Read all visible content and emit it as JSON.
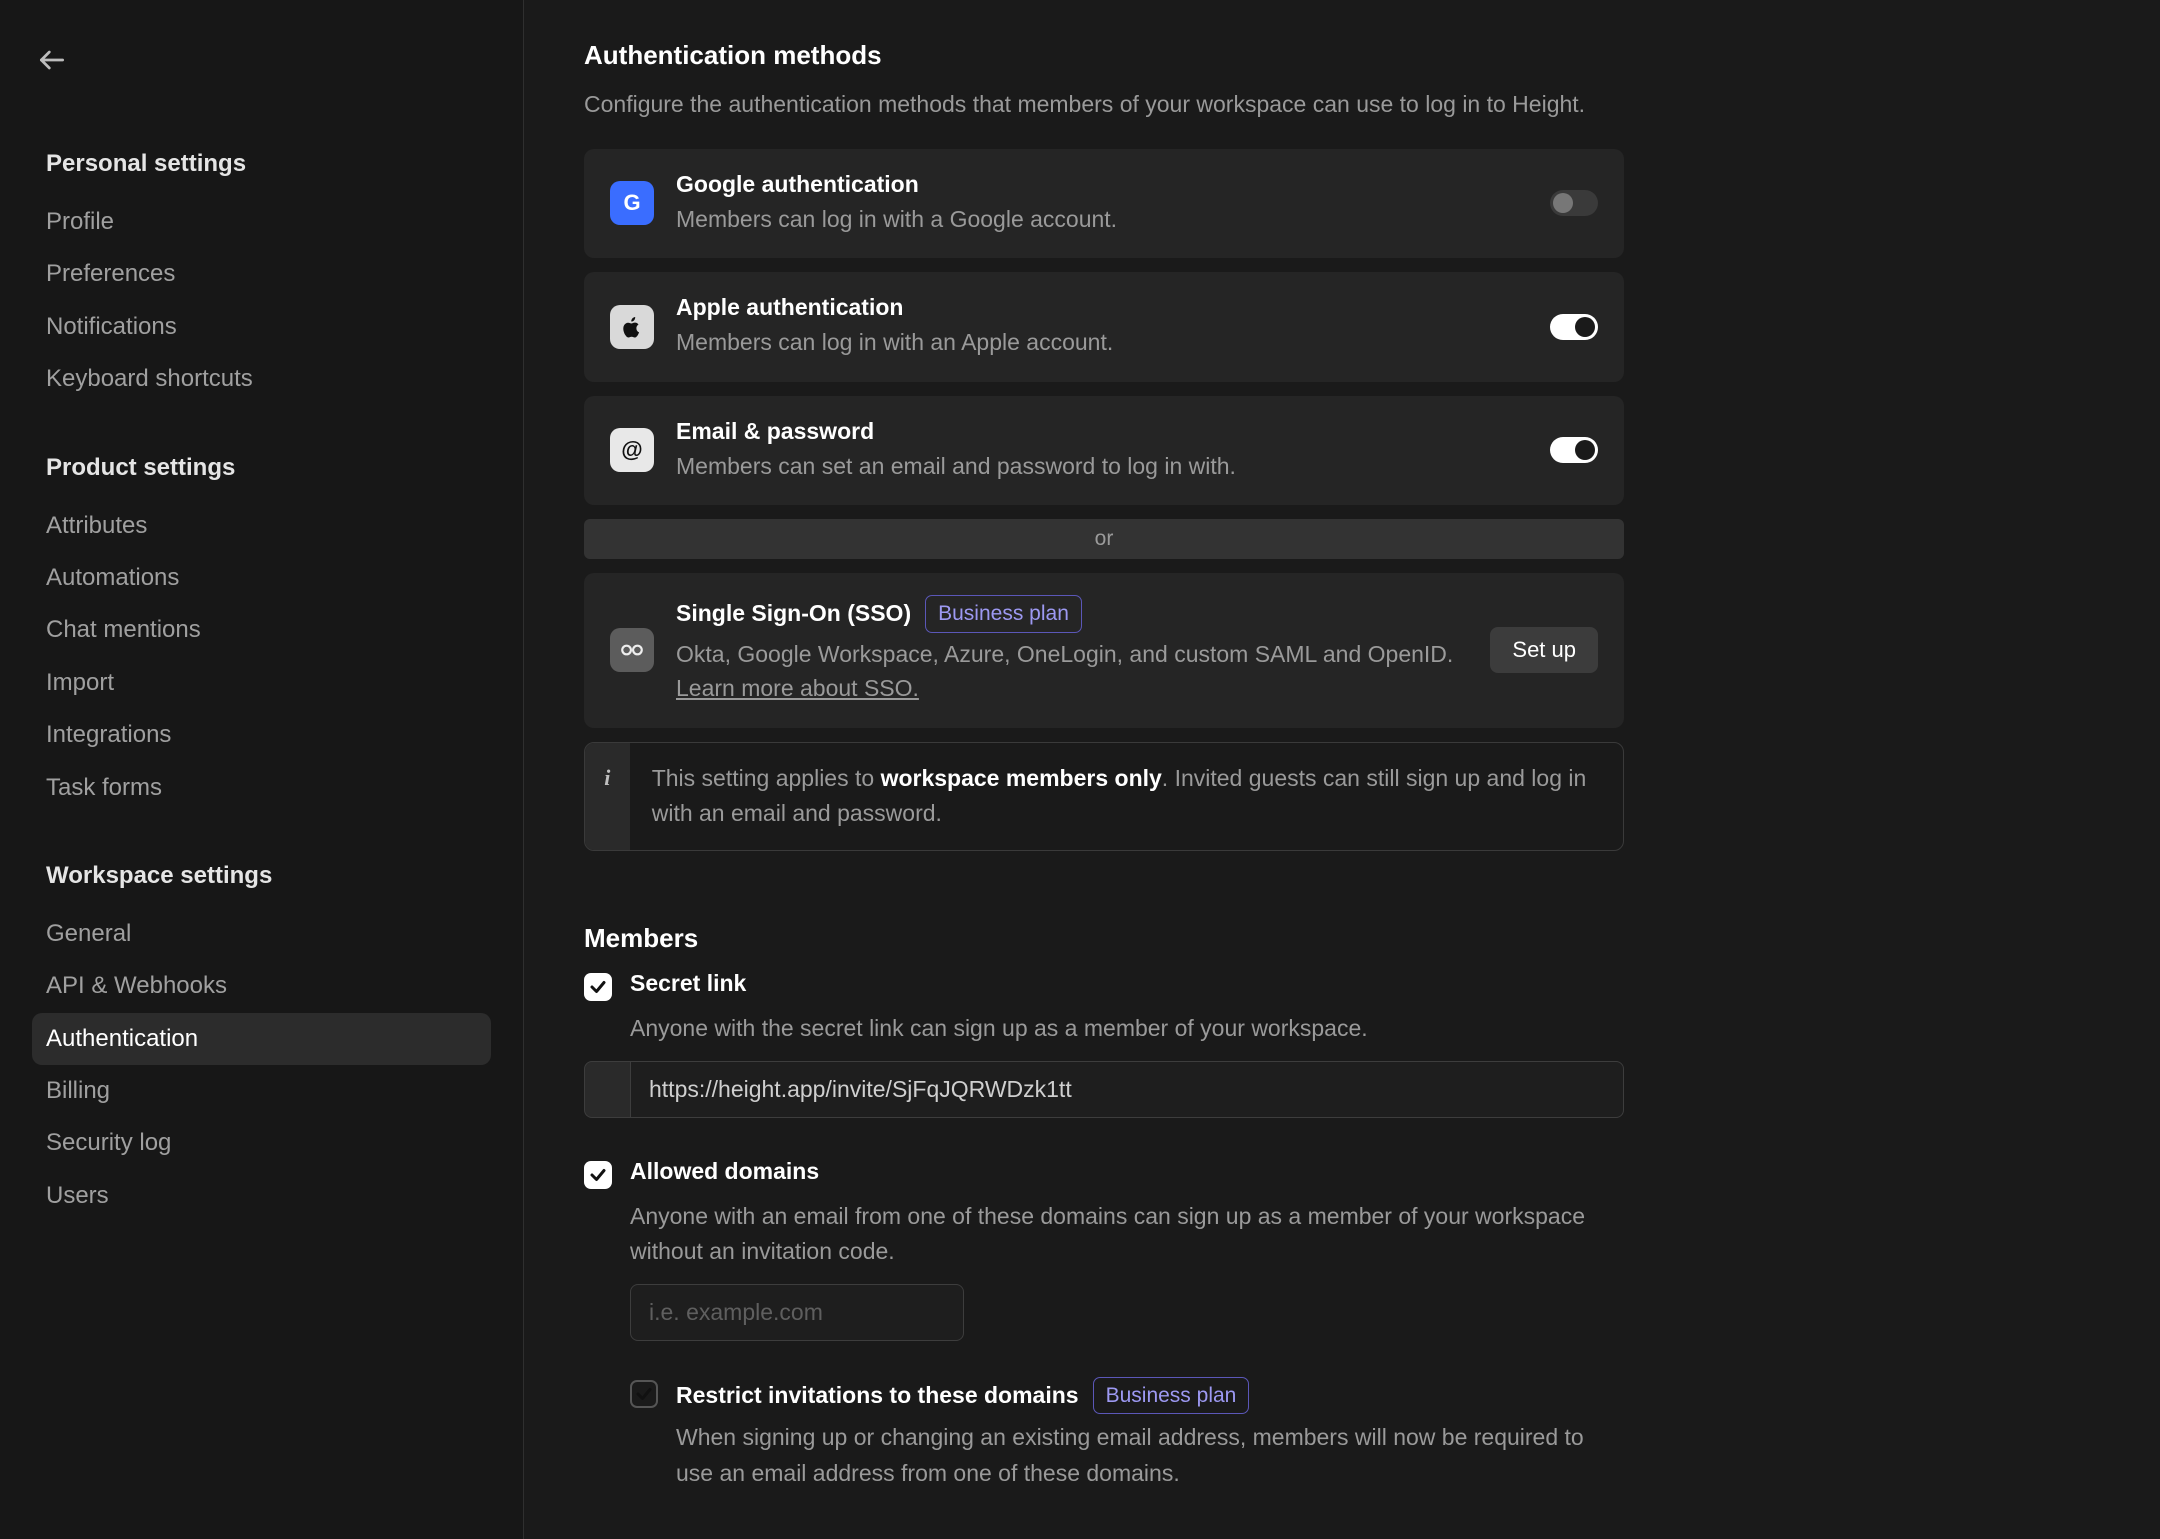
{
  "sidebar": {
    "groups": [
      {
        "heading": "Personal settings",
        "items": [
          {
            "label": "Profile",
            "name": "sidebar-item-profile",
            "active": false
          },
          {
            "label": "Preferences",
            "name": "sidebar-item-preferences",
            "active": false
          },
          {
            "label": "Notifications",
            "name": "sidebar-item-notifications",
            "active": false
          },
          {
            "label": "Keyboard shortcuts",
            "name": "sidebar-item-keyboard-shortcuts",
            "active": false
          }
        ]
      },
      {
        "heading": "Product settings",
        "items": [
          {
            "label": "Attributes",
            "name": "sidebar-item-attributes",
            "active": false
          },
          {
            "label": "Automations",
            "name": "sidebar-item-automations",
            "active": false
          },
          {
            "label": "Chat mentions",
            "name": "sidebar-item-chat-mentions",
            "active": false
          },
          {
            "label": "Import",
            "name": "sidebar-item-import",
            "active": false
          },
          {
            "label": "Integrations",
            "name": "sidebar-item-integrations",
            "active": false
          },
          {
            "label": "Task forms",
            "name": "sidebar-item-task-forms",
            "active": false
          }
        ]
      },
      {
        "heading": "Workspace settings",
        "items": [
          {
            "label": "General",
            "name": "sidebar-item-general",
            "active": false
          },
          {
            "label": "API & Webhooks",
            "name": "sidebar-item-api-webhooks",
            "active": false
          },
          {
            "label": "Authentication",
            "name": "sidebar-item-authentication",
            "active": true
          },
          {
            "label": "Billing",
            "name": "sidebar-item-billing",
            "active": false
          },
          {
            "label": "Security log",
            "name": "sidebar-item-security-log",
            "active": false
          },
          {
            "label": "Users",
            "name": "sidebar-item-users",
            "active": false
          }
        ]
      }
    ]
  },
  "auth_section": {
    "title": "Authentication methods",
    "desc": "Configure the authentication methods that members of your workspace can use to log in to Height.",
    "or_label": "or",
    "setup_label": "Set up",
    "sso_plan_chip": "Business plan",
    "learn_more_label": "Learn more about SSO.",
    "providers": {
      "google": {
        "title": "Google authentication",
        "desc": "Members can log in with a Google account.",
        "on": false
      },
      "apple": {
        "title": "Apple authentication",
        "desc": "Members can log in with an Apple account.",
        "on": true
      },
      "email": {
        "title": "Email & password",
        "desc": "Members can set an email and password to log in with.",
        "on": true
      },
      "sso": {
        "title": "Single Sign-On (SSO)",
        "desc": "Okta, Google Workspace, Azure, OneLogin, and custom SAML and OpenID. "
      }
    },
    "info_note": {
      "prefix": "This setting applies to ",
      "strong": "workspace members only",
      "suffix": ". Invited guests can still sign up and log in with an email and password."
    }
  },
  "members_section": {
    "title": "Members",
    "secret_link": {
      "label": "Secret link",
      "desc": "Anyone with the secret link can sign up as a member of your workspace.",
      "value": "https://height.app/invite/SjFqJQRWDzk1tt",
      "checked": true
    },
    "allowed_domains": {
      "label": "Allowed domains",
      "desc": "Anyone with an email from one of these domains can sign up as a member of your workspace without an invitation code.",
      "placeholder": "i.e. example.com",
      "value": "",
      "checked": true
    },
    "restrict": {
      "label": "Restrict invitations to these domains",
      "plan_chip": "Business plan",
      "desc": "When signing up or changing an existing email address, members will now be required to use an email address from one of these domains.",
      "checked": false
    }
  }
}
